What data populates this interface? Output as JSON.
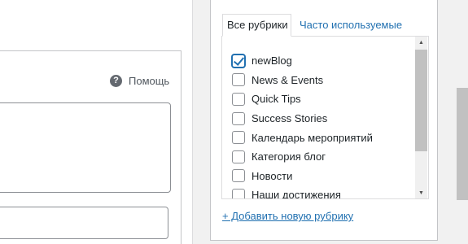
{
  "editor": {
    "help_label": "Помощь",
    "help_icon": "question-circle-icon"
  },
  "categories_panel": {
    "tabs": [
      {
        "label": "Все рубрики",
        "active": true
      },
      {
        "label": "Часто используемые",
        "active": false
      }
    ],
    "items": [
      {
        "label": "newBlog",
        "checked": true
      },
      {
        "label": "News & Events",
        "checked": false
      },
      {
        "label": "Quick Tips",
        "checked": false
      },
      {
        "label": "Success Stories",
        "checked": false
      },
      {
        "label": "Календарь мероприятий",
        "checked": false
      },
      {
        "label": "Категория блог",
        "checked": false
      },
      {
        "label": "Новости",
        "checked": false
      },
      {
        "label": "Наши достижения",
        "checked": false
      }
    ],
    "add_link": "+ Добавить новую рубрику"
  },
  "colors": {
    "accent": "#2271b1",
    "border": "#c3c4c7",
    "background": "#f1f1f1"
  }
}
